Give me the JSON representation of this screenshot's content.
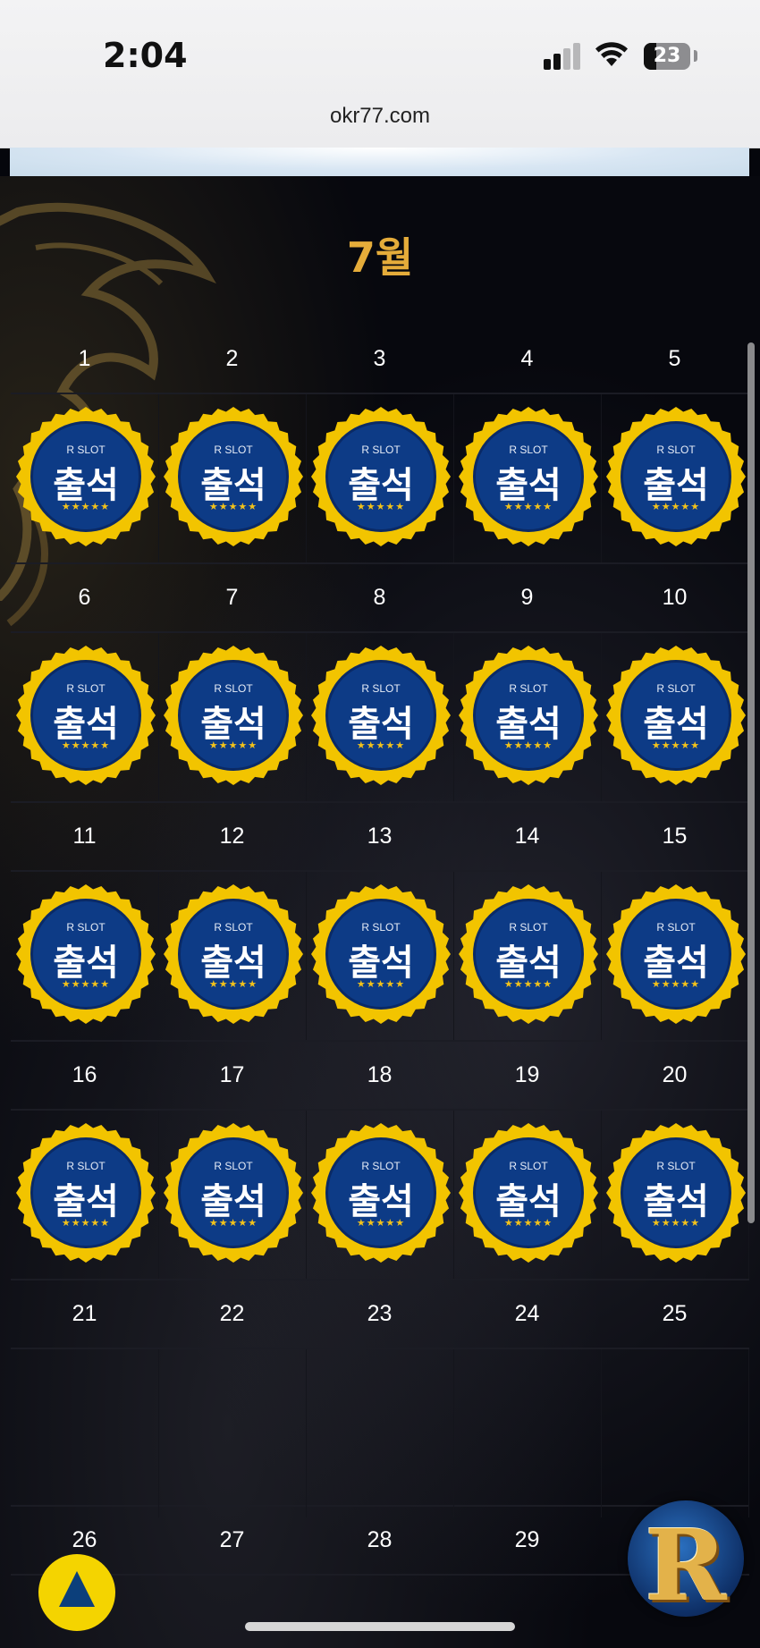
{
  "status_bar": {
    "time": "2:04",
    "battery": "23",
    "url": "okr77.com"
  },
  "calendar": {
    "month": "7월",
    "badge": {
      "brand": "R SLOT",
      "label": "출석",
      "stars": "★★★★★",
      "colors": {
        "ring": "#f2c400",
        "inner": "#0d3b86",
        "star": "#f3c21a"
      }
    },
    "weeks": [
      {
        "days": [
          "1",
          "2",
          "3",
          "4",
          "5"
        ],
        "attended": true
      },
      {
        "days": [
          "6",
          "7",
          "8",
          "9",
          "10"
        ],
        "attended": true
      },
      {
        "days": [
          "11",
          "12",
          "13",
          "14",
          "15"
        ],
        "attended": true
      },
      {
        "days": [
          "16",
          "17",
          "18",
          "19",
          "20"
        ],
        "attended": true
      },
      {
        "days": [
          "21",
          "22",
          "23",
          "24",
          "25"
        ],
        "attended": false
      },
      {
        "days": [
          "26",
          "27",
          "28",
          "29",
          ""
        ],
        "attended": false
      }
    ]
  },
  "floating": {
    "scroll_top_icon": "up-arrow-icon",
    "logo_letter": "R"
  }
}
